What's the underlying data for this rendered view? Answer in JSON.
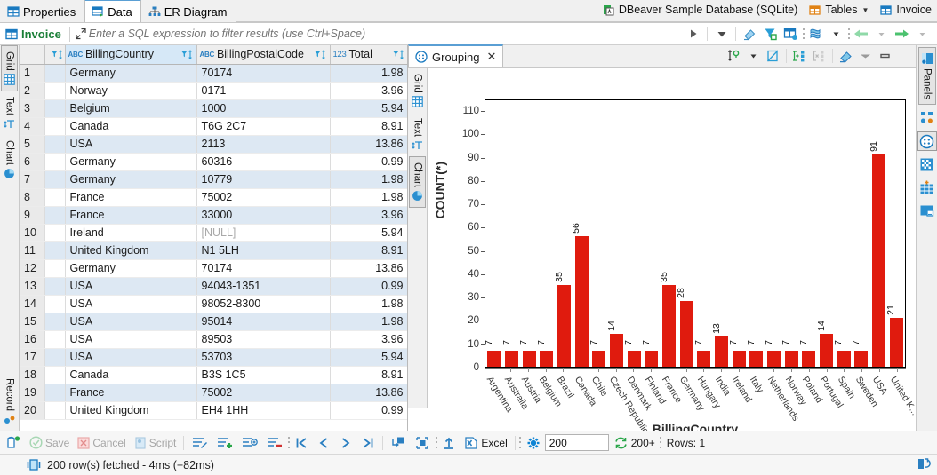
{
  "editor_tabs": [
    {
      "label": "Properties",
      "icon": "table-properties-icon",
      "active": false
    },
    {
      "label": "Data",
      "icon": "data-grid-icon",
      "active": true
    },
    {
      "label": "ER Diagram",
      "icon": "er-diagram-icon",
      "active": false
    }
  ],
  "connection": {
    "database": "DBeaver Sample Database (SQLite)",
    "schema": "Tables",
    "object": "Invoice"
  },
  "filter_bar": {
    "table_name": "Invoice",
    "placeholder": "Enter a SQL expression to filter results (use Ctrl+Space)",
    "value": "",
    "buttons": [
      "apply-filter-button",
      "filter-history-dropdown",
      "clear-filter-button",
      "custom-filter-button",
      "filter-settings-button",
      "save-filter-dropdown",
      "navigate-back-button",
      "navigate-forward-button"
    ]
  },
  "left_panel_tabs": [
    {
      "label": "Grid",
      "icon": "grid-icon",
      "active": true
    },
    {
      "label": "Text",
      "icon": "text-icon",
      "active": false
    },
    {
      "label": "Chart",
      "icon": "pie-chart-icon",
      "active": false
    },
    {
      "label": "Record",
      "icon": "record-icon",
      "active": false
    }
  ],
  "grid": {
    "columns": [
      {
        "label": "",
        "type": "",
        "selected": false
      },
      {
        "label": "BillingCountry",
        "type": "ABC",
        "selected": true
      },
      {
        "label": "BillingPostalCode",
        "type": "ABC",
        "selected": false
      },
      {
        "label": "Total",
        "type": "123",
        "selected": false
      }
    ],
    "rows": [
      {
        "n": "1",
        "country": "Germany",
        "postal": "70174",
        "total": "1.98"
      },
      {
        "n": "2",
        "country": "Norway",
        "postal": "0171",
        "total": "3.96"
      },
      {
        "n": "3",
        "country": "Belgium",
        "postal": "1000",
        "total": "5.94"
      },
      {
        "n": "4",
        "country": "Canada",
        "postal": "T6G 2C7",
        "total": "8.91"
      },
      {
        "n": "5",
        "country": "USA",
        "postal": "2113",
        "total": "13.86"
      },
      {
        "n": "6",
        "country": "Germany",
        "postal": "60316",
        "total": "0.99"
      },
      {
        "n": "7",
        "country": "Germany",
        "postal": "10779",
        "total": "1.98"
      },
      {
        "n": "8",
        "country": "France",
        "postal": "75002",
        "total": "1.98"
      },
      {
        "n": "9",
        "country": "France",
        "postal": "33000",
        "total": "3.96"
      },
      {
        "n": "10",
        "country": "Ireland",
        "postal": "[NULL]",
        "total": "5.94",
        "postal_null": true
      },
      {
        "n": "11",
        "country": "United Kingdom",
        "postal": "N1 5LH",
        "total": "8.91"
      },
      {
        "n": "12",
        "country": "Germany",
        "postal": "70174",
        "total": "13.86"
      },
      {
        "n": "13",
        "country": "USA",
        "postal": "94043-1351",
        "total": "0.99"
      },
      {
        "n": "14",
        "country": "USA",
        "postal": "98052-8300",
        "total": "1.98"
      },
      {
        "n": "15",
        "country": "USA",
        "postal": "95014",
        "total": "1.98"
      },
      {
        "n": "16",
        "country": "USA",
        "postal": "89503",
        "total": "3.96"
      },
      {
        "n": "17",
        "country": "USA",
        "postal": "53703",
        "total": "5.94"
      },
      {
        "n": "18",
        "country": "Canada",
        "postal": "B3S 1C5",
        "total": "8.91"
      },
      {
        "n": "19",
        "country": "France",
        "postal": "75002",
        "total": "13.86"
      },
      {
        "n": "20",
        "country": "United Kingdom",
        "postal": "EH4 1HH",
        "total": "0.99"
      }
    ]
  },
  "chart_panel": {
    "tab_label": "Grouping",
    "tab_icon": "grouping-icon",
    "close_label": "✕",
    "tools": [
      "sort-settings-dropdown",
      "duplicate-rows-button",
      "add-grouping-column-button",
      "remove-grouping-column-button",
      "clear-grouping-button",
      "minimize-button",
      "maximize-button"
    ]
  },
  "middle_panel_tabs": [
    {
      "label": "Grid",
      "icon": "grid-icon",
      "active": false
    },
    {
      "label": "Text",
      "icon": "text-icon",
      "active": false
    },
    {
      "label": "Chart",
      "icon": "pie-chart-icon",
      "active": true
    }
  ],
  "right_strip": {
    "label": "Panels",
    "icon": "panels-icon",
    "items": [
      {
        "name": "value-viewer-icon",
        "selected": false
      },
      {
        "name": "grouping-panel-icon",
        "selected": true
      },
      {
        "name": "calc-panel-icon",
        "selected": false
      },
      {
        "name": "metadata-panel-icon",
        "selected": false
      },
      {
        "name": "references-panel-icon",
        "selected": false
      }
    ]
  },
  "chart_data": {
    "type": "bar",
    "title": "",
    "xlabel": "BillingCountry",
    "ylabel": "COUNT(*)",
    "ylim": [
      0,
      115
    ],
    "yticks": [
      0,
      10,
      20,
      30,
      40,
      50,
      60,
      70,
      80,
      90,
      100,
      110
    ],
    "grid": false,
    "legend": null,
    "bar_color": "#e01b0e",
    "categories": [
      "Argentina",
      "Australia",
      "Austria",
      "Belgium",
      "Brazil",
      "Canada",
      "Chile",
      "Czech Republic",
      "Denmark",
      "Finland",
      "France",
      "Germany",
      "Hungary",
      "India",
      "Ireland",
      "Italy",
      "Netherlands",
      "Norway",
      "Poland",
      "Portugal",
      "Spain",
      "Sweden",
      "USA",
      "United K..."
    ],
    "values": [
      7,
      7,
      7,
      7,
      35,
      56,
      7,
      14,
      7,
      7,
      35,
      28,
      7,
      13,
      7,
      7,
      7,
      7,
      7,
      14,
      7,
      7,
      91,
      21
    ]
  },
  "bottom_toolbar": {
    "buttons": [
      {
        "name": "panel-toggle-button",
        "label": "",
        "disabled": false
      },
      {
        "name": "save-button",
        "label": "Save",
        "disabled": true
      },
      {
        "name": "cancel-button",
        "label": "Cancel",
        "disabled": true
      },
      {
        "name": "script-button",
        "label": "Script",
        "disabled": true
      },
      {
        "name": "edit-row-button",
        "label": "",
        "disabled": false
      },
      {
        "name": "add-row-button",
        "label": "",
        "disabled": false
      },
      {
        "name": "duplicate-row-button",
        "label": "",
        "disabled": false
      },
      {
        "name": "delete-row-button",
        "label": "",
        "disabled": false
      },
      {
        "name": "first-row-button",
        "label": "",
        "disabled": false
      },
      {
        "name": "previous-row-button",
        "label": "",
        "disabled": false
      },
      {
        "name": "next-row-button",
        "label": "",
        "disabled": false
      },
      {
        "name": "last-row-button",
        "label": "",
        "disabled": false
      },
      {
        "name": "refresh-fetch-button",
        "label": "",
        "disabled": false
      },
      {
        "name": "fetch-all-button",
        "label": "",
        "disabled": false
      },
      {
        "name": "import-data-button",
        "label": "",
        "disabled": false
      },
      {
        "name": "export-excel-button",
        "label": "Excel",
        "disabled": false
      }
    ],
    "fetch_settings_icon": "gear-icon",
    "fetch_size": "200",
    "fetch_more_icon": "refresh-icon",
    "fetch_more_label": "200+",
    "rows_label": "Rows: 1"
  },
  "status_bar": {
    "icon": "result-icon",
    "text": "200 row(s) fetched - 4ms (+82ms)",
    "right_icon": "restore-icon"
  }
}
